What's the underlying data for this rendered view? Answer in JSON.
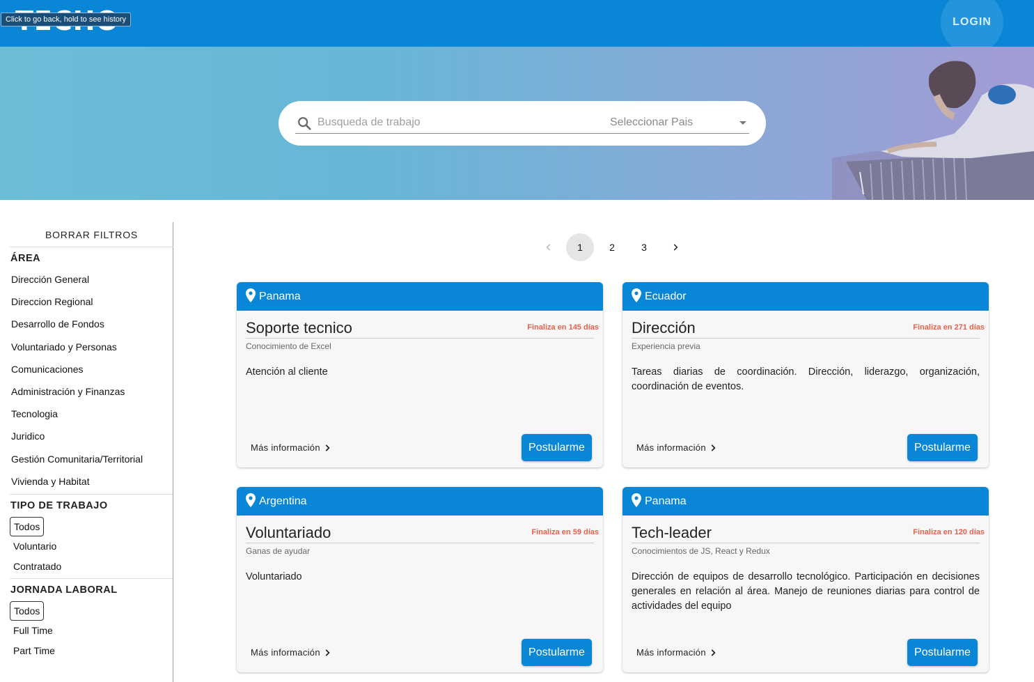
{
  "header": {
    "logo_text": "TECHO",
    "tooltip": "Click to go back, hold to see history",
    "login_label": "LOGIN"
  },
  "search": {
    "placeholder": "Busqueda de trabajo",
    "country_placeholder": "Seleccionar Pais"
  },
  "sidebar": {
    "clear_label": "BORRAR FILTROS",
    "area_title": "ÁREA",
    "areas": [
      "Dirección General",
      "Direccion Regional",
      "Desarrollo de Fondos",
      "Voluntariado y Personas",
      "Comunicaciones",
      "Administración y Finanzas",
      "Tecnologia",
      "Juridico",
      "Gestión Comunitaria/Territorial",
      "Vivienda y Habitat"
    ],
    "job_type_title": "TIPO DE TRABAJO",
    "job_types": [
      "Todos",
      "Voluntario",
      "Contratado"
    ],
    "schedule_title": "JORNADA LABORAL",
    "schedules": [
      "Todos",
      "Full Time",
      "Part Time"
    ]
  },
  "pagination": {
    "pages": [
      "1",
      "2",
      "3"
    ],
    "current": "1"
  },
  "cards": [
    {
      "country": "Panama",
      "title": "Soporte tecnico",
      "deadline": "Finaliza en 145 días",
      "requirement": "Conocimiento de Excel",
      "description": "Atención al cliente",
      "more_label": "Más información",
      "apply_label": "Postularme"
    },
    {
      "country": "Ecuador",
      "title": "Dirección",
      "deadline": "Finaliza en 271 días",
      "requirement": "Experiencia previa",
      "description": "Tareas diarias de coordinación. Dirección, liderazgo, organización, coordinación de eventos.",
      "more_label": "Más información",
      "apply_label": "Postularme"
    },
    {
      "country": "Argentina",
      "title": "Voluntariado",
      "deadline": "Finaliza en 59 días",
      "requirement": "Ganas de ayudar",
      "description": "Voluntariado",
      "more_label": "Más información",
      "apply_label": "Postularme"
    },
    {
      "country": "Panama",
      "title": "Tech-leader",
      "deadline": "Finaliza en 120 días",
      "requirement": "Conocimientos de JS, React y Redux",
      "description": "Dirección de equipos de desarrollo tecnológico. Participación en decisiones generales en relación al área. Manejo de reuniones diarias para control de actividades del equipo",
      "more_label": "Más información",
      "apply_label": "Postularme"
    }
  ],
  "colors": {
    "primary": "#0a86d6",
    "deadline": "#e8604c"
  }
}
